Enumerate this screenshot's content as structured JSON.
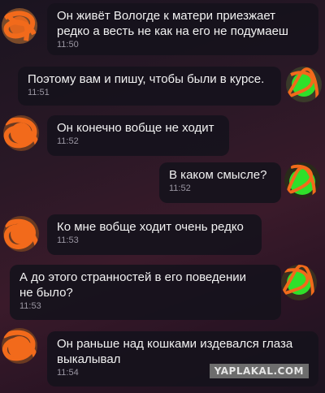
{
  "messages": [
    {
      "side": "incoming",
      "text": "Он живёт Вологде к матери приезжает\nредко а весть не как на его не подумаеш",
      "time": "11:50"
    },
    {
      "side": "outgoing",
      "text": "Поэтому вам и пишу, чтобы были в курсе.",
      "time": "11:51"
    },
    {
      "side": "incoming",
      "text": "Он конечно вобще не ходит",
      "time": "11:52"
    },
    {
      "side": "outgoing",
      "text": "В каком смысле?",
      "time": "11:52"
    },
    {
      "side": "incoming",
      "text": "Ко мне вобще ходит очень редко",
      "time": "11:53"
    },
    {
      "side": "outgoing",
      "text": "А до этого странностей в его поведении\nне было?",
      "time": "11:53"
    },
    {
      "side": "incoming",
      "text": "Он раньше над кошками издевался глаза\nвыкалывал",
      "time": "11:54"
    }
  ],
  "avatars": {
    "incoming_scribble_color": "#f26a1b",
    "outgoing_scribble_color": "#2fe02a"
  },
  "watermark": "YAPLAKAL.COM"
}
